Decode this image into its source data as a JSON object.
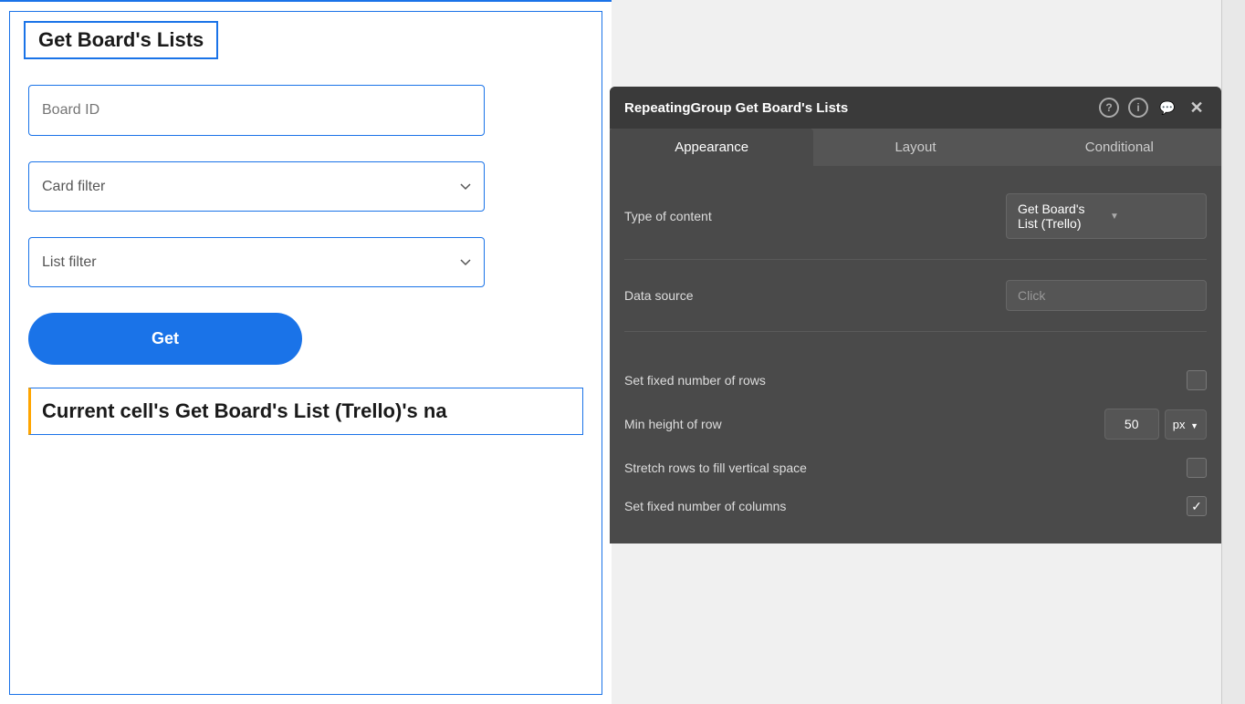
{
  "canvas": {
    "title": "Get Board's Lists",
    "board_id_placeholder": "Board ID",
    "card_filter_placeholder": "Card filter",
    "list_filter_placeholder": "List filter",
    "get_button_label": "Get",
    "cell_text": "Current cell's Get Board's List (Trello)'s na"
  },
  "panel": {
    "title": "RepeatingGroup Get Board's Lists",
    "icons": {
      "help": "?",
      "info": "i",
      "chat": "💬",
      "close": "✕"
    },
    "tabs": [
      {
        "id": "appearance",
        "label": "Appearance",
        "active": true
      },
      {
        "id": "layout",
        "label": "Layout",
        "active": false
      },
      {
        "id": "conditional",
        "label": "Conditional",
        "active": false
      }
    ],
    "fields": {
      "type_of_content_label": "Type of content",
      "type_of_content_value": "Get Board's List (Trello)",
      "data_source_label": "Data source",
      "data_source_placeholder": "Click",
      "set_fixed_rows_label": "Set fixed number of rows",
      "min_height_label": "Min height of row",
      "min_height_value": "50",
      "min_height_unit": "px",
      "stretch_rows_label": "Stretch rows to fill vertical space",
      "set_fixed_columns_label": "Set fixed number of columns"
    }
  }
}
